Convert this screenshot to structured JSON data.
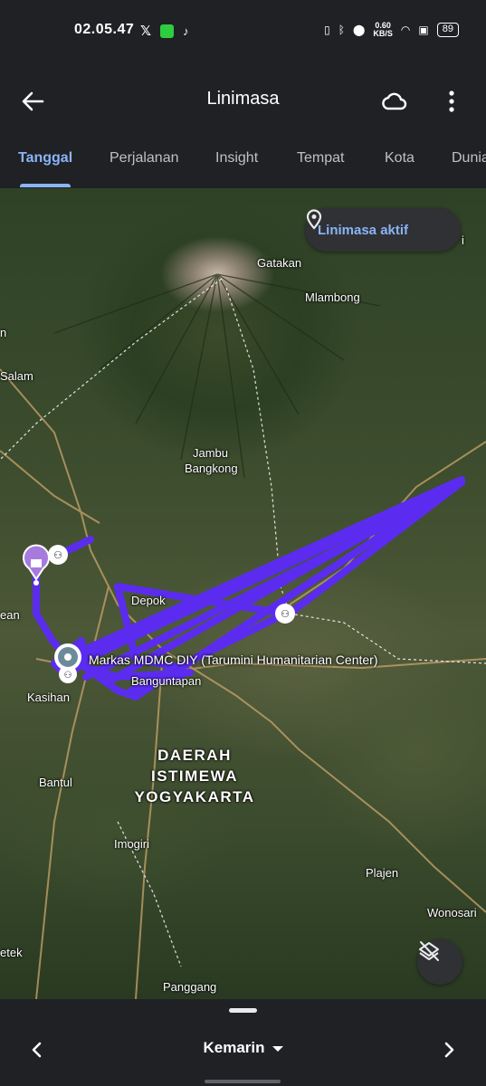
{
  "status_bar": {
    "time": "02.05.47",
    "speed_value": "0.60",
    "speed_unit": "KB/S",
    "battery": "89"
  },
  "appbar": {
    "title": "Linimasa"
  },
  "tabs": [
    {
      "label": "Tanggal",
      "active": true
    },
    {
      "label": "Perjalanan",
      "active": false
    },
    {
      "label": "Insight",
      "active": false
    },
    {
      "label": "Tempat",
      "active": false
    },
    {
      "label": "Kota",
      "active": false
    },
    {
      "label": "Dunia",
      "active": false
    }
  ],
  "map": {
    "chip_label": "Linimasa aktif",
    "places": {
      "gatakan": "Gatakan",
      "mlambong": "Mlambong",
      "jambu": "Jambu",
      "bangkong": "Bangkong",
      "depok": "Depok",
      "banguntapan": "Banguntapan",
      "kasihan": "Kasihan",
      "bantul": "Bantul",
      "imogiri": "Imogiri",
      "plajen": "Plajen",
      "wonosari": "Wonosari",
      "panggang": "Panggang",
      "salam": "Salam",
      "edge_n": "n",
      "edge_ean": "ean",
      "edge_etek": "etek",
      "edge_i": "i"
    },
    "region": [
      "DAERAH",
      "ISTIMEWA",
      "YOGYAKARTA"
    ],
    "marker_label": "Markas MDMC DIY (Tarumini Humanitarian Center)",
    "route_color": "#5b2cf0"
  },
  "bottom": {
    "date_label": "Kemarin"
  }
}
